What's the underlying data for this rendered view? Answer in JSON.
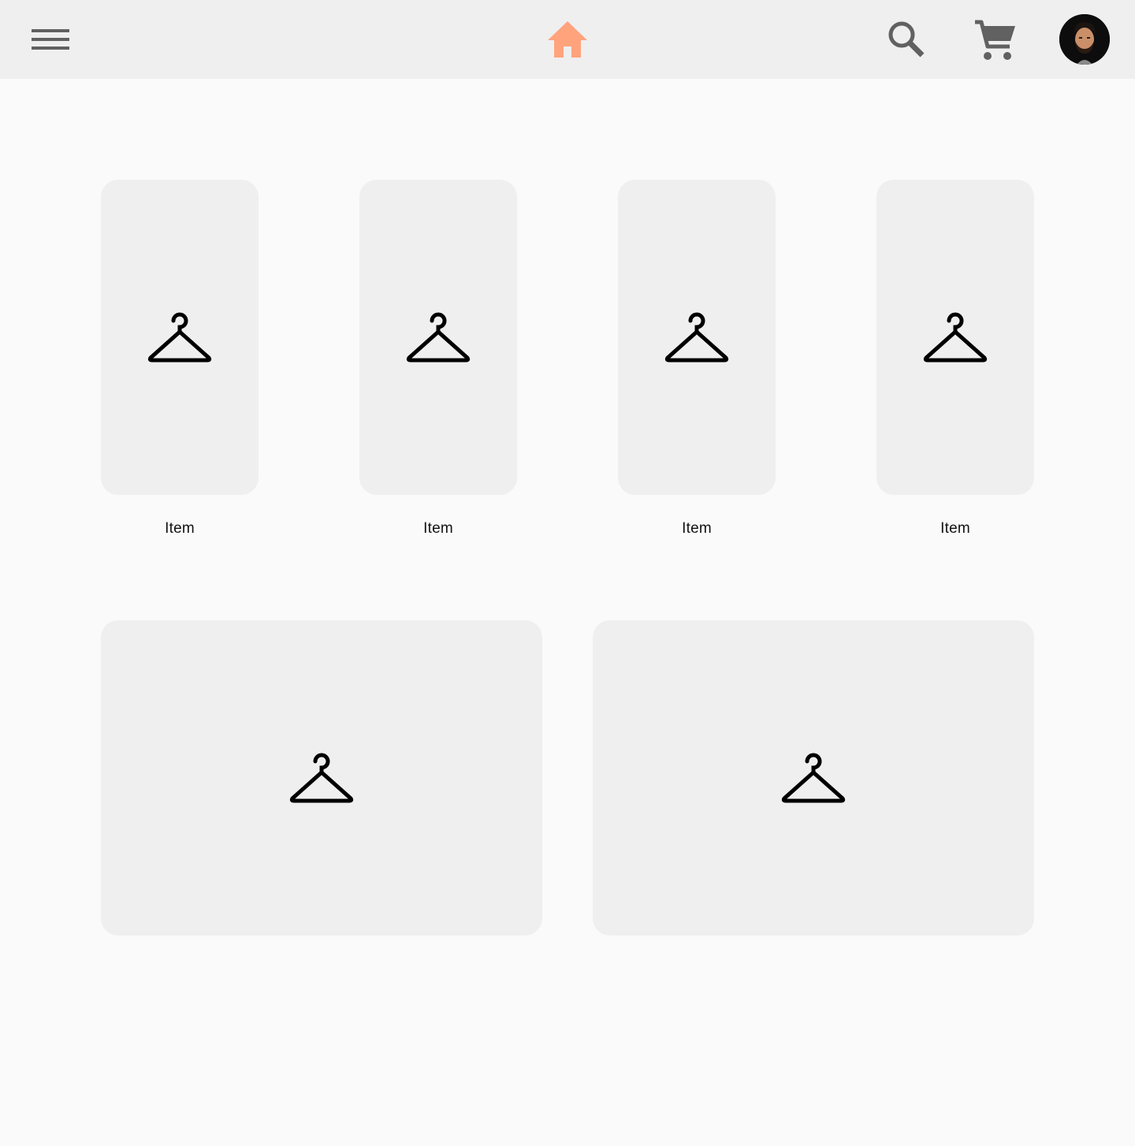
{
  "header": {
    "menu_icon": "hamburger-menu-icon",
    "home_icon": "home-icon",
    "search_icon": "search-icon",
    "cart_icon": "shopping-cart-icon",
    "avatar_icon": "user-avatar",
    "home_color": "#ffa37d",
    "icon_color": "#616161"
  },
  "products": [
    {
      "label": "Item",
      "icon": "hanger-icon"
    },
    {
      "label": "Item",
      "icon": "hanger-icon"
    },
    {
      "label": "Item",
      "icon": "hanger-icon"
    },
    {
      "label": "Item",
      "icon": "hanger-icon"
    }
  ],
  "banners": [
    {
      "icon": "hanger-icon"
    },
    {
      "icon": "hanger-icon"
    }
  ]
}
